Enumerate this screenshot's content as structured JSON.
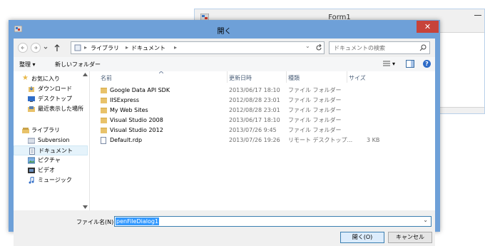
{
  "form1": {
    "title": "Form1"
  },
  "dialog": {
    "title": "開く",
    "close_label": "✕",
    "breadcrumb": {
      "sep1": "▸",
      "item1": "ライブラリ",
      "sep2": "▸",
      "item2": "ドキュメント",
      "sep3": "▸",
      "dropdown": "⌄"
    },
    "search_placeholder": "ドキュメントの検索",
    "nav_icons": {
      "back": "arrow-left-icon",
      "forward": "arrow-right-icon",
      "recent": "chevron-down-icon",
      "up": "arrow-up-icon",
      "refresh": "refresh-icon",
      "search": "search-icon"
    },
    "toolbar": {
      "organize": "整理 ▾",
      "new_folder": "新しいフォルダー",
      "view_dropdown": "▾",
      "help": "?"
    },
    "nav_pane": {
      "favorites_header": "お気に入り",
      "favorites": [
        "ダウンロード",
        "デスクトップ",
        "最近表示した場所"
      ],
      "libraries_header": "ライブラリ",
      "libraries": [
        "Subversion",
        "ドキュメント",
        "ピクチャ",
        "ビデオ",
        "ミュージック"
      ]
    },
    "columns": {
      "name": "名前",
      "date": "更新日時",
      "type": "種類",
      "size": "サイズ"
    },
    "files": [
      {
        "name": "Google Data API SDK",
        "date": "2013/06/17 18:10",
        "type": "ファイル フォルダー",
        "size": "",
        "kind": "folder"
      },
      {
        "name": "IISExpress",
        "date": "2012/08/28 23:01",
        "type": "ファイル フォルダー",
        "size": "",
        "kind": "folder"
      },
      {
        "name": "My Web Sites",
        "date": "2012/08/28 23:01",
        "type": "ファイル フォルダー",
        "size": "",
        "kind": "folder"
      },
      {
        "name": "Visual Studio 2008",
        "date": "2013/06/17 18:10",
        "type": "ファイル フォルダー",
        "size": "",
        "kind": "folder"
      },
      {
        "name": "Visual Studio 2012",
        "date": "2013/07/26 9:45",
        "type": "ファイル フォルダー",
        "size": "",
        "kind": "folder"
      },
      {
        "name": "Default.rdp",
        "date": "2013/07/26 19:26",
        "type": "リモート デスクトップ...",
        "size": "3 KB",
        "kind": "file"
      }
    ],
    "filename_label": "ファイル名(N):",
    "filename_value": "penFileDialog1",
    "filename_dropdown": "⌄",
    "open_button": "開く(O)",
    "cancel_button": "キャンセル"
  }
}
